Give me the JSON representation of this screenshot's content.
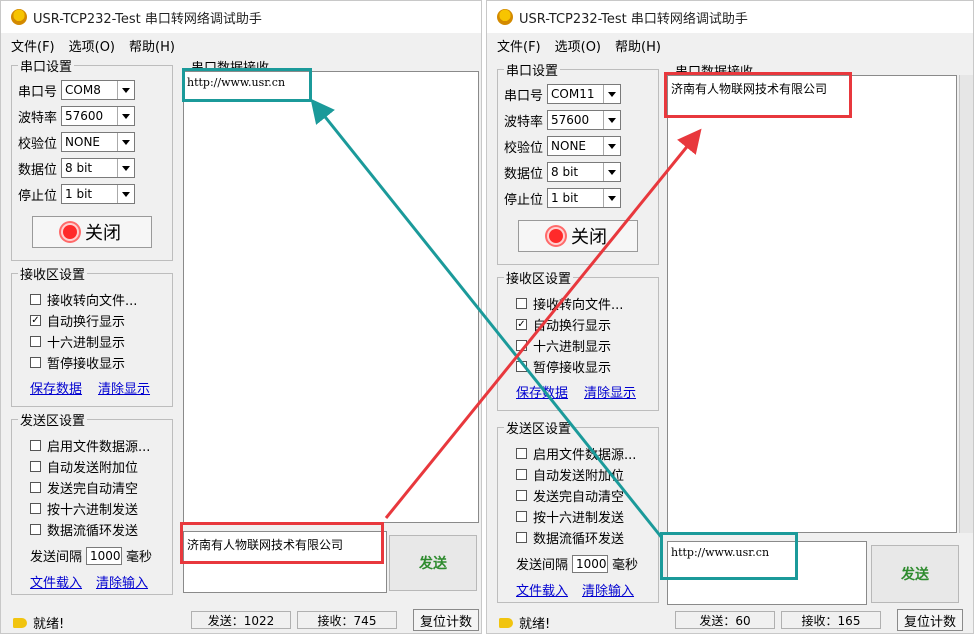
{
  "left": {
    "title": "USR-TCP232-Test 串口转网络调试助手",
    "menu": [
      "文件(F)",
      "选项(O)",
      "帮助(H)"
    ],
    "serial_group": "串口设置",
    "fields": [
      {
        "label": "串口号",
        "value": "COM8"
      },
      {
        "label": "波特率",
        "value": "57600"
      },
      {
        "label": "校验位",
        "value": "NONE"
      },
      {
        "label": "数据位",
        "value": "8 bit"
      },
      {
        "label": "停止位",
        "value": "1 bit"
      }
    ],
    "close_label": "关闭",
    "recv_group": "接收区设置",
    "recv_opts": [
      {
        "label": "接收转向文件...",
        "checked": false
      },
      {
        "label": "自动换行显示",
        "checked": true
      },
      {
        "label": "十六进制显示",
        "checked": false
      },
      {
        "label": "暂停接收显示",
        "checked": false
      }
    ],
    "save_link": "保存数据",
    "clear_link": "清除显示",
    "send_group": "发送区设置",
    "send_opts": [
      {
        "label": "启用文件数据源...",
        "checked": false
      },
      {
        "label": "自动发送附加位",
        "checked": false
      },
      {
        "label": "发送完自动清空",
        "checked": false
      },
      {
        "label": "按十六进制发送",
        "checked": false
      },
      {
        "label": "数据流循环发送",
        "checked": false
      }
    ],
    "interval_label": "发送间隔",
    "interval_value": "1000",
    "interval_unit": "毫秒",
    "load_link": "文件载入",
    "clear_input_link": "清除输入",
    "recv_area_label": "串口数据接收",
    "recv_text": "http://www.usr.cn",
    "send_text": "济南有人物联网技术有限公司",
    "send_button": "发送",
    "status_ready": "就绪!",
    "status_sent": "发送：1022",
    "status_recv": "接收：745",
    "reset_button": "复位计数"
  },
  "right": {
    "title": "USR-TCP232-Test 串口转网络调试助手",
    "menu": [
      "文件(F)",
      "选项(O)",
      "帮助(H)"
    ],
    "serial_group": "串口设置",
    "fields": [
      {
        "label": "串口号",
        "value": "COM11"
      },
      {
        "label": "波特率",
        "value": "57600"
      },
      {
        "label": "校验位",
        "value": "NONE"
      },
      {
        "label": "数据位",
        "value": "8 bit"
      },
      {
        "label": "停止位",
        "value": "1 bit"
      }
    ],
    "close_label": "关闭",
    "recv_group": "接收区设置",
    "recv_opts": [
      {
        "label": "接收转向文件...",
        "checked": false
      },
      {
        "label": "自动换行显示",
        "checked": true
      },
      {
        "label": "十六进制显示",
        "checked": false
      },
      {
        "label": "暂停接收显示",
        "checked": false
      }
    ],
    "save_link": "保存数据",
    "clear_link": "清除显示",
    "send_group": "发送区设置",
    "send_opts": [
      {
        "label": "启用文件数据源...",
        "checked": false
      },
      {
        "label": "自动发送附加位",
        "checked": false
      },
      {
        "label": "发送完自动清空",
        "checked": false
      },
      {
        "label": "按十六进制发送",
        "checked": false
      },
      {
        "label": "数据流循环发送",
        "checked": false
      }
    ],
    "interval_label": "发送间隔",
    "interval_value": "1000",
    "interval_unit": "毫秒",
    "load_link": "文件载入",
    "clear_input_link": "清除输入",
    "recv_area_label": "串口数据接收",
    "recv_text": "济南有人物联网技术有限公司",
    "send_text": "http://www.usr.cn",
    "send_button": "发送",
    "status_ready": "就绪!",
    "status_sent": "发送：60",
    "status_recv": "接收：165",
    "reset_button": "复位计数"
  },
  "colors": {
    "red_highlight": "#e8383d",
    "teal_highlight": "#1b9a9a"
  }
}
